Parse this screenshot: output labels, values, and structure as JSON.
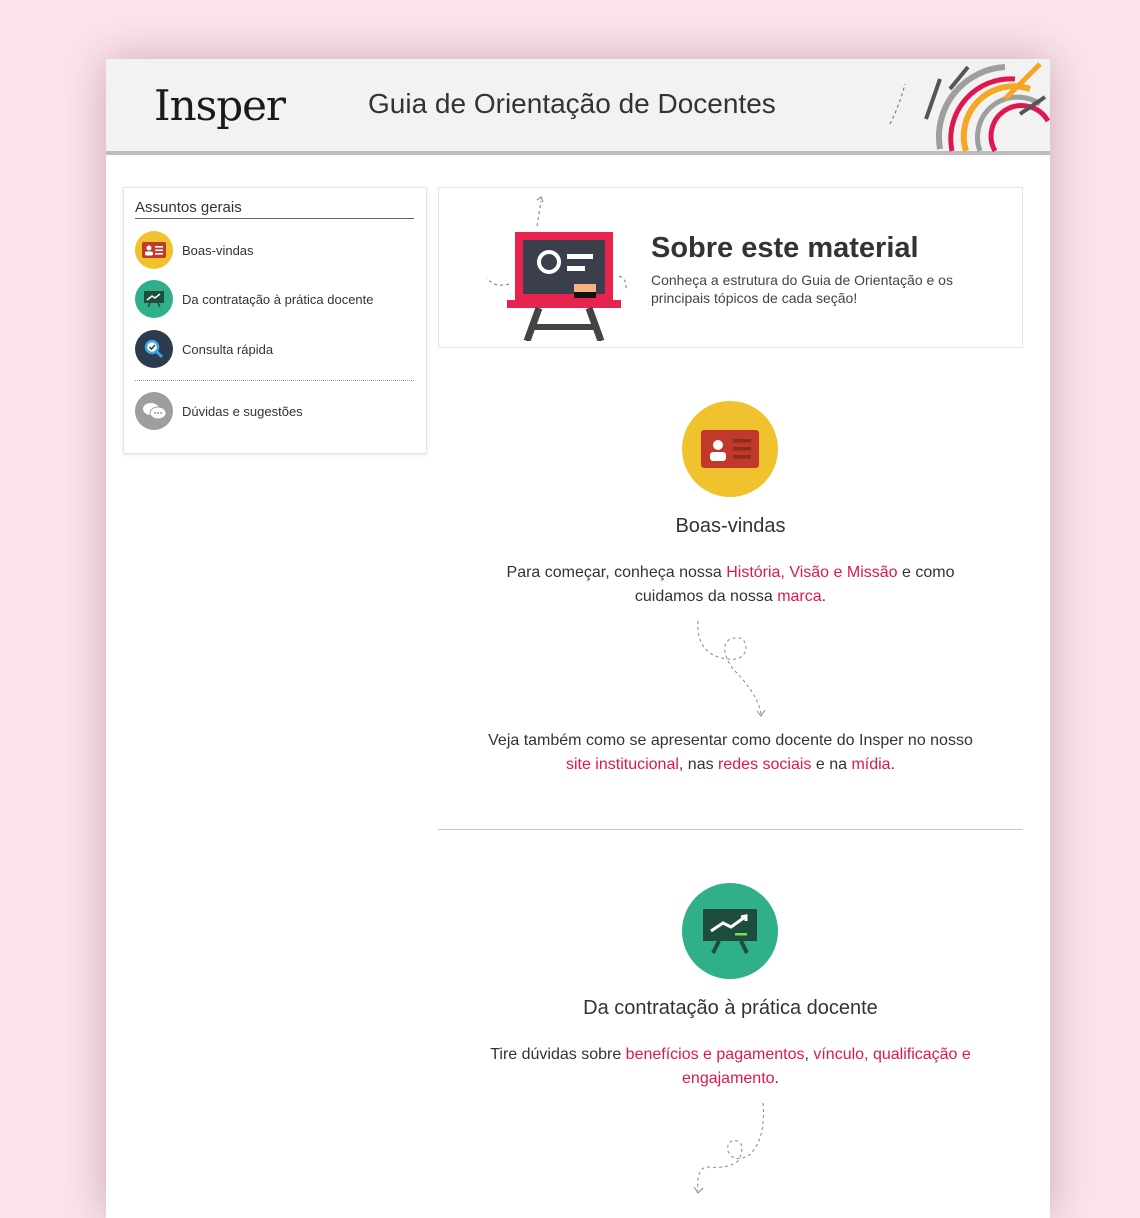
{
  "header": {
    "logo": "Insper",
    "title": "Guia de Orientação de Docentes"
  },
  "sidebar": {
    "title": "Assuntos gerais",
    "items": [
      {
        "label": "Boas-vindas",
        "icon": "id-card-icon",
        "color": "#f0c32e"
      },
      {
        "label": "Da contratação à prática docente",
        "icon": "presentation-board-icon",
        "color": "#2fb08a"
      },
      {
        "label": "Consulta rápida",
        "icon": "magnifier-icon",
        "color": "#2d3b4f"
      }
    ],
    "extra": {
      "label": "Dúvidas e sugestões",
      "icon": "chat-bubbles-icon",
      "color": "#9e9e9e"
    }
  },
  "about": {
    "title": "Sobre este material",
    "description": "Conheça a estrutura do Guia de Orientação e os principais tópicos de cada seção!"
  },
  "sections": [
    {
      "title": "Boas-vindas",
      "p1": {
        "before": "Para começar, conheça nossa ",
        "link1": "História, Visão e Missão",
        "mid": " e como cuidamos da nossa ",
        "link2": "marca",
        "after": "."
      },
      "p2": {
        "before": "Veja também como se apresentar como docente do Insper no nosso ",
        "link1": "site institucional",
        "mid1": ", nas ",
        "link2": "redes sociais",
        "mid2": " e na ",
        "link3": "mídia",
        "after": "."
      }
    },
    {
      "title": "Da contratação à prática docente",
      "p1": {
        "before": "Tire dúvidas sobre ",
        "link1": "benefícios e pagamentos",
        "mid": ", ",
        "link2": "vínculo, qualificação e engajamento",
        "after": "."
      }
    }
  ],
  "colors": {
    "accent": "#e0174f",
    "yellow": "#f0c32e",
    "green": "#2fb08a",
    "navy": "#2d3b4f",
    "background": "#fbe4ea"
  }
}
